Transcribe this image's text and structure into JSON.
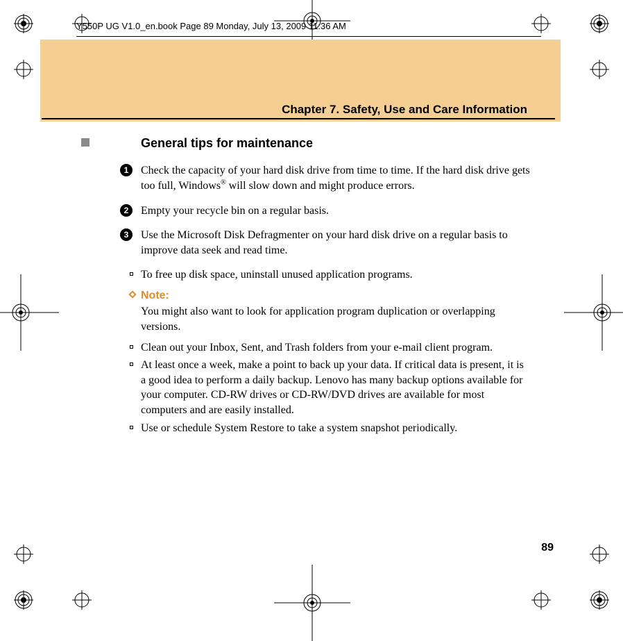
{
  "runner": "Y550P UG V1.0_en.book  Page 89  Monday, July 13, 2009  11:36 AM",
  "chapter": "Chapter 7. Safety, Use and Care Information",
  "section_heading": "General tips for maintenance",
  "numbered_items": [
    {
      "num": "1",
      "text_pre": "Check the capacity of your hard disk drive from time to time. If the hard disk drive gets too full, Windows",
      "sup": "®",
      "text_post": " will slow down and might produce errors."
    },
    {
      "num": "2",
      "text_pre": "Empty your recycle bin on a regular basis.",
      "sup": "",
      "text_post": ""
    },
    {
      "num": "3",
      "text_pre": "Use the Microsoft Disk Defragmenter on your hard disk drive on a regular basis to improve data seek and read time.",
      "sup": "",
      "text_post": ""
    }
  ],
  "square_items_before_note": [
    "To free up disk space, uninstall unused application programs."
  ],
  "note": {
    "label": "Note:",
    "body": "You might also want to look for application program duplication or overlapping versions."
  },
  "square_items_after_note": [
    "Clean out your Inbox, Sent, and Trash folders from your e-mail client program.",
    "At least once a week, make a point to back up your data. If critical data is present, it is a good idea to perform a daily backup. Lenovo has many backup options available for your computer. CD-RW drives or CD-RW/DVD drives are available for most computers and are easily installed.",
    "Use or schedule System Restore to take a system snapshot periodically."
  ],
  "page_number": "89"
}
